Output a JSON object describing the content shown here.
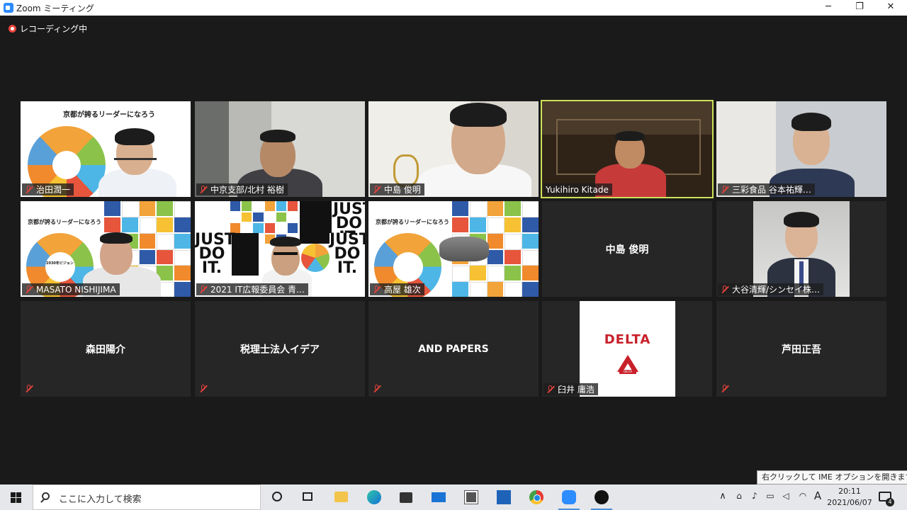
{
  "window": {
    "title": "Zoom ミーティング"
  },
  "recording": {
    "label": "レコーディング中"
  },
  "tiles": [
    {
      "name": "治田潤一"
    },
    {
      "name": "中京支部/北村 裕樹"
    },
    {
      "name": "中島 俊明"
    },
    {
      "name": "Yukihiro Kitade"
    },
    {
      "name": "三彩食品 谷本祐輝…"
    },
    {
      "name": "MASATO NISHIJIMA"
    },
    {
      "name": "2021 IT広報委員会 青…"
    },
    {
      "name": "高屋 雄次"
    },
    {
      "name": "中島 俊明"
    },
    {
      "name": "大谷清輝/シンセイ株…"
    },
    {
      "name": "森田陽介"
    },
    {
      "name": "税理士法人イデア"
    },
    {
      "name": "AND PAPERS"
    },
    {
      "name": "臼井 庸浩"
    },
    {
      "name": "芦田正吾"
    }
  ],
  "slides": {
    "title": "京都が誇るリーダーになろう",
    "year": "2030年ビジョン"
  },
  "posters": {
    "just": "JUST",
    "doit": "DO IT."
  },
  "delta_card": {
    "word": "DELTA",
    "brand": "DELTA"
  },
  "tooltip": {
    "text": "右クリックして IME オプションを開きます"
  },
  "taskbar": {
    "search_placeholder": "ここに入力して検索",
    "ime": "A",
    "time": "20:11",
    "date": "2021/06/07",
    "notification_count": "4"
  },
  "colors": {
    "active_speaker": "#cde15a",
    "muted_mic": "#e0413a",
    "recording": "#e8453c",
    "zoom_blue": "#2d8cff"
  }
}
